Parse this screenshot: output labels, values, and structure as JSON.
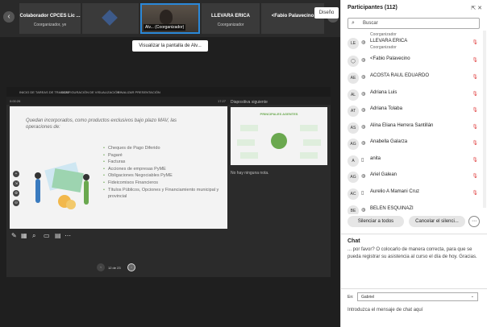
{
  "top": {
    "tiles": [
      {
        "name": "Colaborador CPCES Lic ...",
        "sub": "Coorganizador, ye"
      },
      {
        "name": "Alv...",
        "sub": "(Coorganizador)"
      },
      {
        "name": "LLEVARA ERICA",
        "sub": "Coorganizador"
      },
      {
        "name": "<Fabio Palavecino",
        "sub": ""
      }
    ],
    "design_label": "Diseño",
    "share_label": "Visualizar la pantalla de Alv..."
  },
  "presentation": {
    "tabs": [
      "INICIO DE TAREAS DE TRABAJO",
      "CONFIGURACIÓN DE VISUALIZACIÓN",
      "FINALIZAR PRESENTACIÓN"
    ],
    "time_left": "0:00:26",
    "time_right": "17:27",
    "slide_intro": "Quedan incorporados, como productos exclusivos bajo plazo MAV, las operaciones de:",
    "bullets": [
      "Cheques de Pago Diferido",
      "Pagaré",
      "Facturas",
      "Acciones de empresas PyME",
      "Obligaciones Negociables PyME",
      "Fideicomisos Financieros",
      "Títulos Públicos, Opciones y Financiamiento municipal y provincial"
    ],
    "next_slide_label": "Diapositiva siguiente",
    "next_slide_title": "PRINCIPALES AGENTES",
    "notes_label": "No hay ninguna nota.",
    "page_label": "12 de 23"
  },
  "participants": {
    "title": "Participantes (112)",
    "search_placeholder": "Buscar",
    "rows": [
      {
        "initials": "",
        "name": "",
        "role": "Coorganizador"
      },
      {
        "initials": "LE",
        "name": "LLEVARA ERICA",
        "role": "Coorganizador"
      },
      {
        "initials": "",
        "name": "<Fabio Palavecino",
        "role": ""
      },
      {
        "initials": "AE",
        "name": "ACOSTA RAUL EDUARDO",
        "role": ""
      },
      {
        "initials": "AL",
        "name": "Adriana Luis",
        "role": ""
      },
      {
        "initials": "AT",
        "name": "Adriana Tolaba",
        "role": ""
      },
      {
        "initials": "AS",
        "name": "Alina Eliana Herrera Santillán",
        "role": ""
      },
      {
        "initials": "AG",
        "name": "Anabella Galarza",
        "role": ""
      },
      {
        "initials": "A",
        "name": "anita",
        "role": ""
      },
      {
        "initials": "AG",
        "name": "Ariel Galean",
        "role": ""
      },
      {
        "initials": "AC",
        "name": "Aurelio A Mamani Cruz",
        "role": ""
      },
      {
        "initials": "BE",
        "name": "BELEN ESQUINAZI",
        "role": ""
      }
    ],
    "mute_all": "Silenciar a todos",
    "cancel_mute": "Cancelar el silenci..."
  },
  "chat": {
    "title": "Chat",
    "message": "... por favor? O colocarlo de manera correcta, para que se pueda registrar su asistencia al curso el día de hoy. Gracias.",
    "to_label": "En:",
    "to_value": "Gabriel",
    "input_placeholder": "Introduzca el mensaje de chat aquí"
  }
}
